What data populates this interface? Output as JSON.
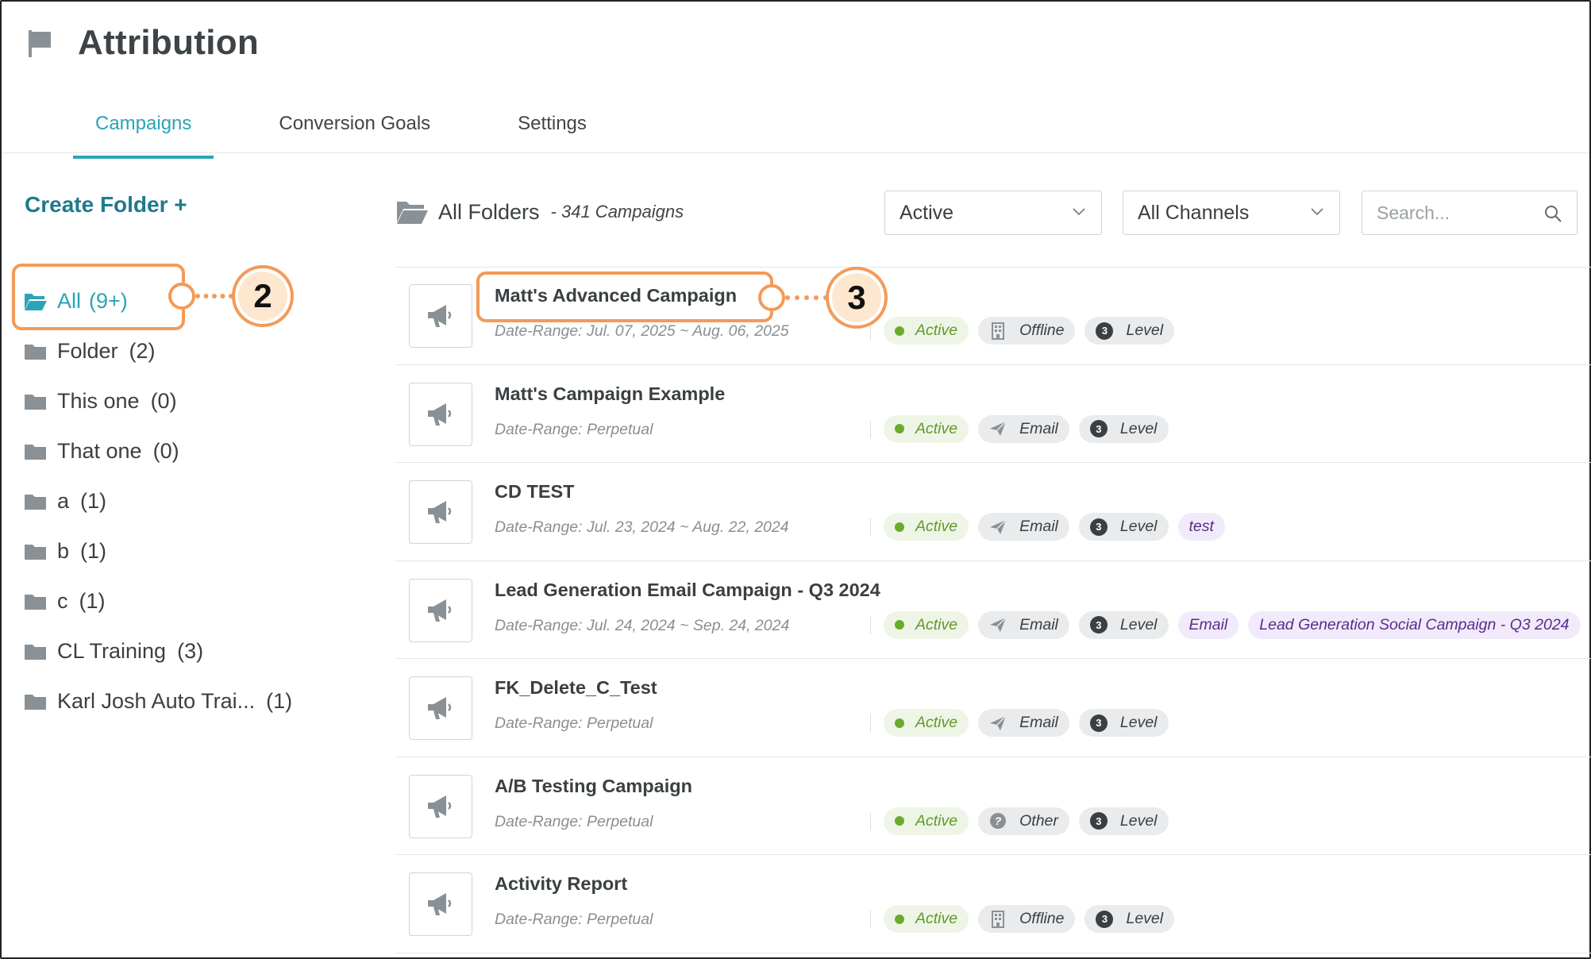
{
  "header": {
    "title": "Attribution",
    "icon": "flag-icon"
  },
  "tabs": [
    {
      "label": "Campaigns",
      "active": true
    },
    {
      "label": "Conversion Goals",
      "active": false
    },
    {
      "label": "Settings",
      "active": false
    }
  ],
  "sidebar": {
    "create_label": "Create Folder +",
    "folders": [
      {
        "name": "All",
        "count": "(9+)",
        "active": true
      },
      {
        "name": "Folder",
        "count": "(2)"
      },
      {
        "name": "This one",
        "count": "(0)"
      },
      {
        "name": "That one",
        "count": "(0)"
      },
      {
        "name": "a",
        "count": "(1)"
      },
      {
        "name": "b",
        "count": "(1)"
      },
      {
        "name": "c",
        "count": "(1)"
      },
      {
        "name": "CL Training",
        "count": "(3)"
      },
      {
        "name": "Karl Josh Auto Trai...",
        "count": "(1)"
      }
    ]
  },
  "main": {
    "folder_title": "All Folders",
    "campaign_count": "- 341 Campaigns",
    "status_filter": "Active",
    "channel_filter": "All Channels",
    "search_placeholder": "Search..."
  },
  "callouts": {
    "first": "2",
    "second": "3"
  },
  "level_number": "3",
  "colors": {
    "accent": "#2aa4b6",
    "callout": "#f39a58",
    "active_green": "#6aab2e",
    "tag_purple": "#5b2b8a"
  },
  "campaigns": [
    {
      "name": "Matt's Advanced Campaign",
      "date": "Date-Range: Jul. 07, 2025 ~ Aug. 06, 2025",
      "status": "Active",
      "channel": "Offline",
      "channel_icon": "building-icon",
      "level": "Level",
      "tags": []
    },
    {
      "name": "Matt's Campaign Example",
      "date": "Date-Range: Perpetual",
      "status": "Active",
      "channel": "Email",
      "channel_icon": "paper-plane-icon",
      "level": "Level",
      "tags": []
    },
    {
      "name": "CD TEST",
      "date": "Date-Range: Jul. 23, 2024 ~ Aug. 22, 2024",
      "status": "Active",
      "channel": "Email",
      "channel_icon": "paper-plane-icon",
      "level": "Level",
      "tags": [
        "test"
      ]
    },
    {
      "name": "Lead Generation Email Campaign - Q3 2024",
      "date": "Date-Range: Jul. 24, 2024 ~ Sep. 24, 2024",
      "status": "Active",
      "channel": "Email",
      "channel_icon": "paper-plane-icon",
      "level": "Level",
      "tags": [
        "Email",
        "Lead Generation Social Campaign - Q3 2024"
      ]
    },
    {
      "name": "FK_Delete_C_Test",
      "date": "Date-Range: Perpetual",
      "status": "Active",
      "channel": "Email",
      "channel_icon": "paper-plane-icon",
      "level": "Level",
      "tags": []
    },
    {
      "name": "A/B Testing Campaign",
      "date": "Date-Range: Perpetual",
      "status": "Active",
      "channel": "Other",
      "channel_icon": "question-icon",
      "level": "Level",
      "tags": []
    },
    {
      "name": "Activity Report",
      "date": "Date-Range: Perpetual",
      "status": "Active",
      "channel": "Offline",
      "channel_icon": "building-icon",
      "level": "Level",
      "tags": []
    }
  ]
}
